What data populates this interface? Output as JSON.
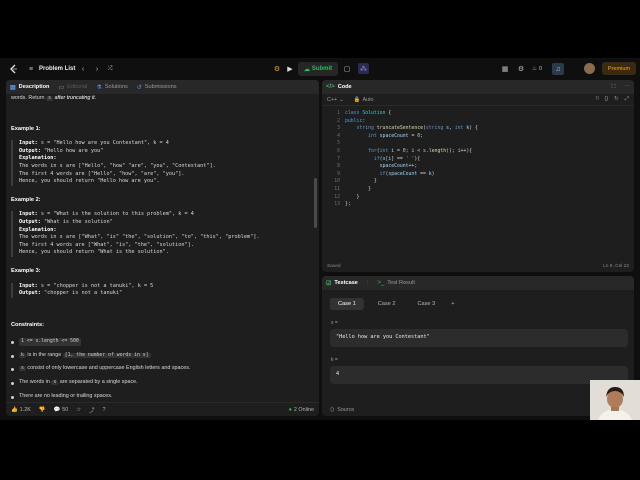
{
  "topbar": {
    "problem_list": "Problem List",
    "submit": "Submit",
    "notifications": "0",
    "premium": "Premium"
  },
  "desc": {
    "tabs": [
      {
        "label": "Description"
      },
      {
        "label": "Editorial"
      },
      {
        "label": "Solutions"
      },
      {
        "label": "Submissions"
      }
    ],
    "intro_a": "words. Return",
    "intro_code": "s",
    "intro_b": "after truncating it.",
    "examples": [
      {
        "title": "Example 1:",
        "input": "s = \"Hello how are you Contestant\", k = 4",
        "output": "\"Hello how are you\"",
        "expl_label": "Explanation:",
        "expl": [
          "The words in s are [\"Hello\", \"how\" \"are\", \"you\", \"Contestant\"].",
          "The first 4 words are [\"Hello\", \"how\", \"are\", \"you\"].",
          "Hence, you should return \"Hello how are you\"."
        ]
      },
      {
        "title": "Example 2:",
        "input": "s = \"What is the solution to this problem\", k = 4",
        "output": "\"What is the solution\"",
        "expl_label": "Explanation:",
        "expl": [
          "The words in s are [\"What\", \"is\" \"the\", \"solution\", \"to\", \"this\", \"problem\"].",
          "The first 4 words are [\"What\", \"is\", \"the\", \"solution\"].",
          "Hence, you should return \"What is the solution\"."
        ]
      },
      {
        "title": "Example 3:",
        "input": "s = \"chopper is not a tanuki\", k = 5",
        "output": "\"chopper is not a tanuki\""
      }
    ],
    "input_label": "Input:",
    "output_label": "Output:",
    "constraints_title": "Constraints:",
    "c1_code": "1 <= s.length <= 500",
    "c2_code_a": "k",
    "c2_text": "is in the range",
    "c2_code_b": "[1, the number of words in s]",
    "c3_code": "s",
    "c3_text": "consist of only lowercase and uppercase English letters and spaces.",
    "c4_a": "The words in",
    "c4_code": "s",
    "c4_b": "are separated by a single space.",
    "c5": "There are no leading or trailing spaces.",
    "likes": "1.2K",
    "comments": "50",
    "online": "2 Online"
  },
  "code": {
    "title": "Code",
    "lang": "C++",
    "mode": "Auto",
    "status": "Saved",
    "cursor": "Ln 9, Col 22",
    "line_numbers": [
      "1",
      "2",
      "3",
      "4",
      "5",
      "6",
      "7",
      "8",
      "9",
      "10",
      "11",
      "12",
      "13"
    ]
  },
  "test": {
    "tab_testcase": "Testcase",
    "tab_result": "Test Result",
    "cases": [
      "Case 1",
      "Case 2",
      "Case 3"
    ],
    "add": "+",
    "s_label": "s =",
    "s_value": "\"Hello how are you Contestant\"",
    "k_label": "k =",
    "k_value": "4",
    "source": "Source"
  },
  "colors": {
    "accent": "#2cbb5d",
    "brand": "#ffa116"
  }
}
